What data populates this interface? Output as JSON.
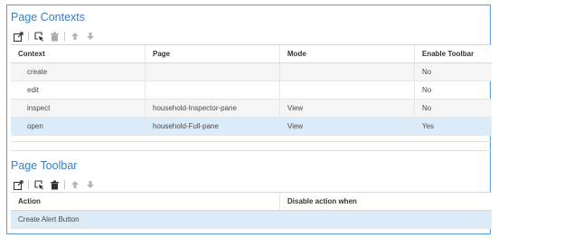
{
  "contexts": {
    "title": "Page Contexts",
    "toolbar": {
      "icons": [
        "export-icon",
        "select-icon",
        "delete-icon",
        "move-up-icon",
        "move-down-icon"
      ]
    },
    "columns": [
      "Context",
      "Page",
      "Mode",
      "Enable Toolbar"
    ],
    "rows": [
      {
        "context": "create",
        "page": "",
        "mode": "",
        "enable_toolbar": "No"
      },
      {
        "context": "edit",
        "page": "",
        "mode": "",
        "enable_toolbar": "No"
      },
      {
        "context": "inspect",
        "page": "household-Inspector-pane",
        "mode": "View",
        "enable_toolbar": "No"
      },
      {
        "context": "open",
        "page": "household-Full-pane",
        "mode": "View",
        "enable_toolbar": "Yes",
        "selected": true
      }
    ]
  },
  "page_toolbar": {
    "title": "Page Toolbar",
    "toolbar": {
      "icons": [
        "export-icon",
        "select-icon",
        "delete-icon",
        "move-up-icon",
        "move-down-icon"
      ]
    },
    "columns": [
      "Action",
      "Disable action when"
    ],
    "rows": [
      {
        "action": "Create Alert Button",
        "disable_when": "",
        "selected": true
      }
    ]
  },
  "colors": {
    "accent": "#3a7fc1",
    "border": "#5b9bd5",
    "selected_row": "#dcebf8"
  }
}
